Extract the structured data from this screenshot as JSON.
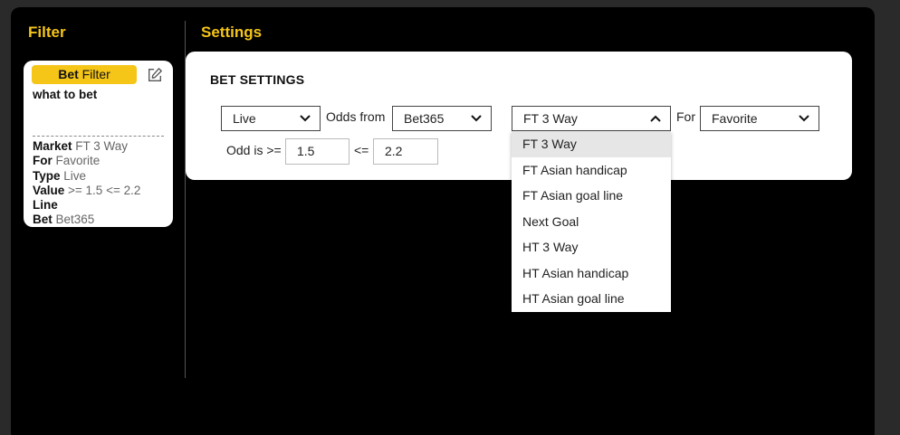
{
  "filter_panel": {
    "title": "Filter",
    "chip_bold": "Bet",
    "chip_text": " Filter",
    "what_to_bet": "what to bet",
    "summary": [
      {
        "key": "Market",
        "value": " FT 3 Way"
      },
      {
        "key": "For",
        "value": " Favorite"
      },
      {
        "key": "Type",
        "value": " Live"
      },
      {
        "key": "Value",
        "value": " >= 1.5 <= 2.2"
      },
      {
        "key": "Line",
        "value": ""
      },
      {
        "key": "Bet",
        "value": " Bet365"
      }
    ]
  },
  "settings_panel": {
    "title": "Settings",
    "heading": "BET SETTINGS",
    "type_select": "Live",
    "odds_from_label": "Odds from",
    "bookmaker_select": "Bet365",
    "market_select": "FT 3 Way",
    "for_label": "For",
    "for_select": "Favorite",
    "odd_is_label": "Odd is >=",
    "min_odd": "1.5",
    "le_label": "<=",
    "max_odd": "2.2"
  },
  "market_dropdown": {
    "options": [
      "FT 3 Way",
      "FT Asian handicap",
      "FT Asian goal line",
      "Next Goal",
      "HT 3 Way",
      "HT Asian handicap",
      "HT Asian goal line"
    ],
    "selected": "FT 3 Way"
  },
  "colors": {
    "accent": "#f5c518",
    "background": "#000000",
    "card": "#ffffff"
  }
}
